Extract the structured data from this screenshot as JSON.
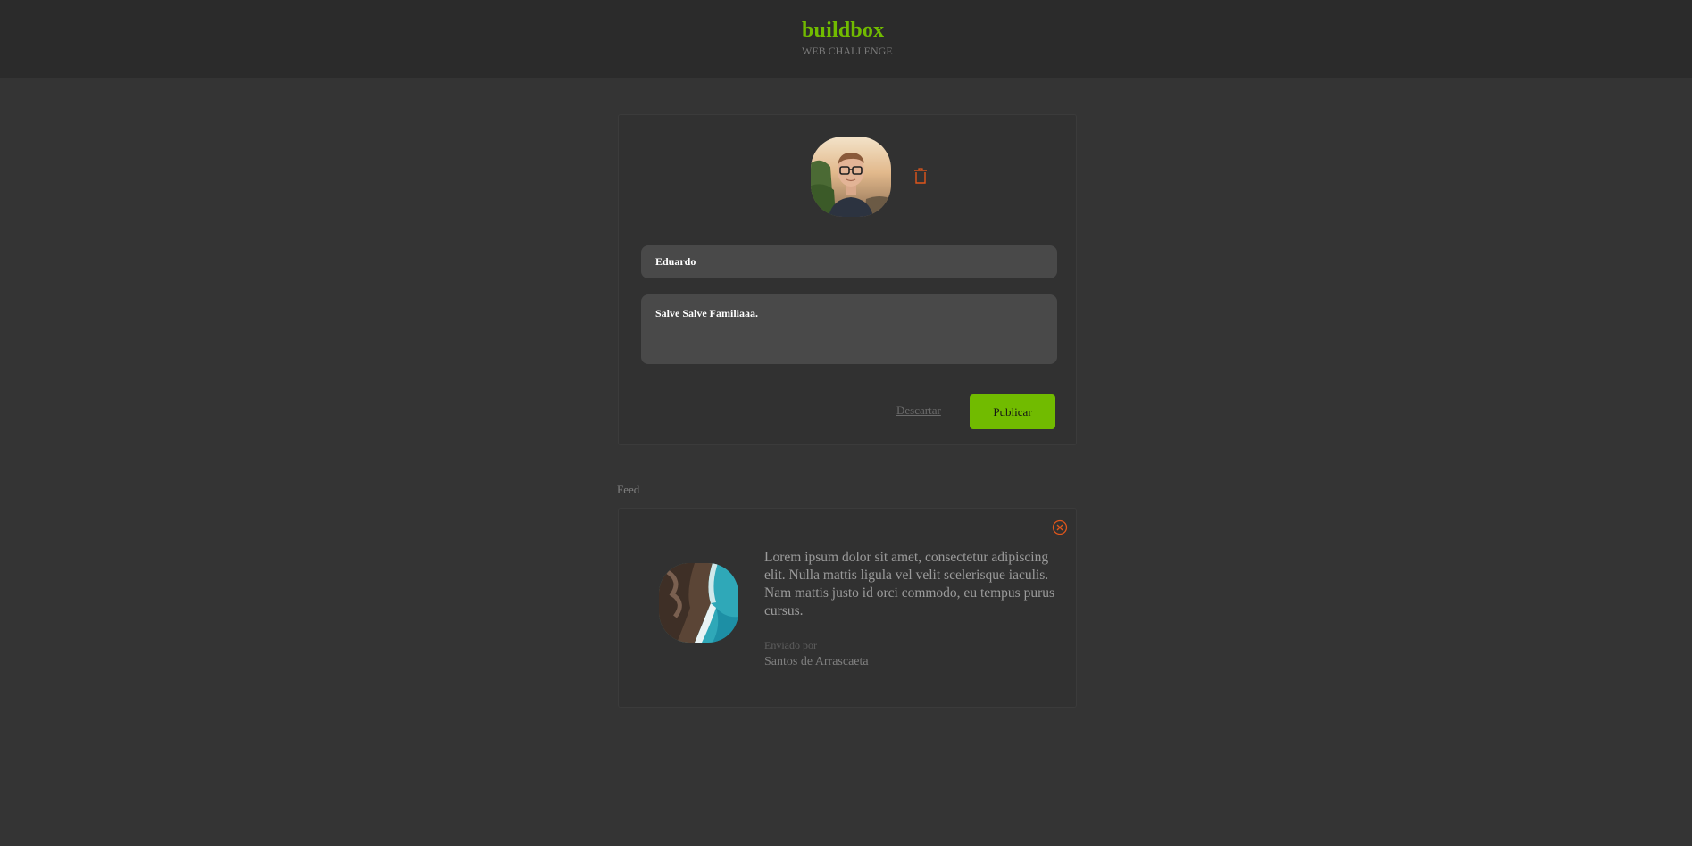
{
  "header": {
    "brand_name": "buildbox",
    "brand_sub": "WEB CHALLENGE"
  },
  "composer": {
    "avatar_icon": "user-photo",
    "remove_photo_icon": "trash-icon",
    "name_value": "Eduardo",
    "message_value": "Salve  Salve Familiaaa.",
    "discard_label": "Descartar",
    "publish_label": "Publicar"
  },
  "feed": {
    "label": "Feed",
    "posts": [
      {
        "delete_icon": "close-circle-icon",
        "image_icon": "coastline-photo",
        "text": "Lorem ipsum dolor sit amet, consectetur adipiscing elit. Nulla mattis ligula vel velit scelerisque iaculis. Nam mattis justo id orci commodo, eu tempus purus cursus.",
        "sent_by_label": "Enviado por",
        "author": "Santos de Arrascaeta"
      }
    ]
  },
  "colors": {
    "accent": "#71bb00",
    "danger": "#e0561b",
    "background": "#343434",
    "header": "#2b2b2b",
    "card": "#313131",
    "input": "#494949"
  }
}
